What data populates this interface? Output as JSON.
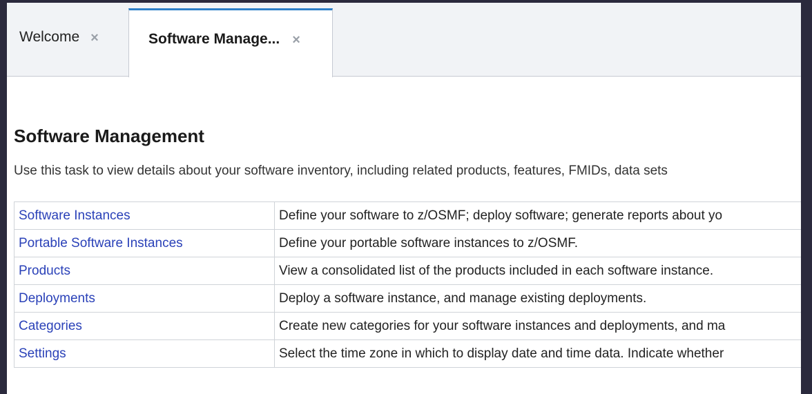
{
  "tabs": [
    {
      "label": "Welcome",
      "close": "×"
    },
    {
      "label": "Software Manage...",
      "close": "×"
    }
  ],
  "page": {
    "title": "Software Management",
    "description": "Use this task to view details about your software inventory, including related products, features, FMIDs, data sets"
  },
  "rows": [
    {
      "name": "Software Instances",
      "desc": "Define your software to z/OSMF; deploy software; generate reports about yo"
    },
    {
      "name": "Portable Software Instances",
      "desc": "Define your portable software instances to z/OSMF."
    },
    {
      "name": "Products",
      "desc": "View a consolidated list of the products included in each software instance."
    },
    {
      "name": "Deployments",
      "desc": "Deploy a software instance, and manage existing deployments."
    },
    {
      "name": "Categories",
      "desc": "Create new categories for your software instances and deployments, and ma"
    },
    {
      "name": "Settings",
      "desc": "Select the time zone in which to display date and time data. Indicate whether"
    }
  ]
}
